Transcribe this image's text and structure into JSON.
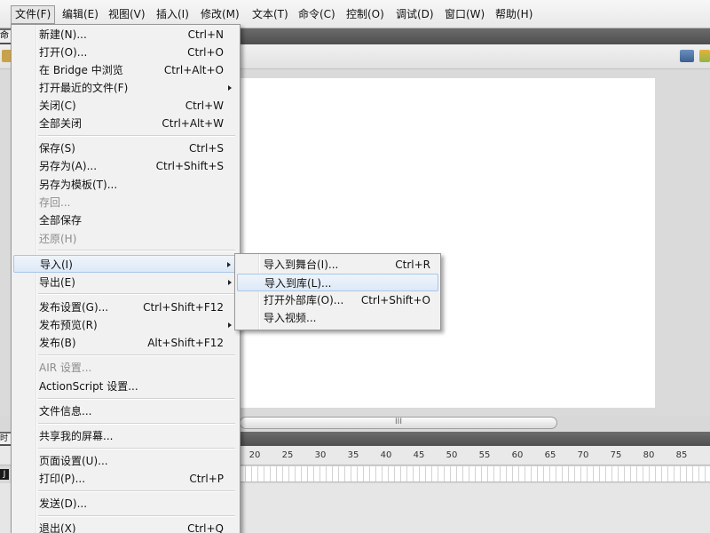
{
  "menubar": {
    "items": [
      "文件(F)",
      "编辑(E)",
      "视图(V)",
      "插入(I)",
      "修改(M)",
      "文本(T)",
      "命令(C)",
      "控制(O)",
      "调试(D)",
      "窗口(W)",
      "帮助(H)"
    ],
    "active": "文件(F)"
  },
  "file_menu": {
    "new": {
      "label": "新建(N)...",
      "shortcut": "Ctrl+N"
    },
    "open": {
      "label": "打开(O)...",
      "shortcut": "Ctrl+O"
    },
    "browse_bridge": {
      "label": "在 Bridge 中浏览",
      "shortcut": "Ctrl+Alt+O"
    },
    "open_recent": {
      "label": "打开最近的文件(F)"
    },
    "close": {
      "label": "关闭(C)",
      "shortcut": "Ctrl+W"
    },
    "close_all": {
      "label": "全部关闭",
      "shortcut": "Ctrl+Alt+W"
    },
    "save": {
      "label": "保存(S)",
      "shortcut": "Ctrl+S"
    },
    "save_as": {
      "label": "另存为(A)...",
      "shortcut": "Ctrl+Shift+S"
    },
    "save_as_template": {
      "label": "另存为模板(T)..."
    },
    "check_in": {
      "label": "存回..."
    },
    "save_all": {
      "label": "全部保存"
    },
    "revert": {
      "label": "还原(H)"
    },
    "import": {
      "label": "导入(I)"
    },
    "export": {
      "label": "导出(E)"
    },
    "publish_settings": {
      "label": "发布设置(G)...",
      "shortcut": "Ctrl+Shift+F12"
    },
    "publish_preview": {
      "label": "发布预览(R)"
    },
    "publish": {
      "label": "发布(B)",
      "shortcut": "Alt+Shift+F12"
    },
    "air_settings": {
      "label": "AIR 设置..."
    },
    "actionscript_settings": {
      "label": "ActionScript 设置..."
    },
    "file_info": {
      "label": "文件信息..."
    },
    "share_screen": {
      "label": "共享我的屏幕..."
    },
    "page_setup": {
      "label": "页面设置(U)..."
    },
    "print": {
      "label": "打印(P)...",
      "shortcut": "Ctrl+P"
    },
    "send": {
      "label": "发送(D)..."
    },
    "exit": {
      "label": "退出(X)",
      "shortcut": "Ctrl+Q"
    }
  },
  "import_submenu": {
    "to_stage": {
      "label": "导入到舞台(I)...",
      "shortcut": "Ctrl+R"
    },
    "to_library": {
      "label": "导入到库(L)..."
    },
    "open_external_library": {
      "label": "打开外部库(O)...",
      "shortcut": "Ctrl+Shift+O"
    },
    "video": {
      "label": "导入视频..."
    }
  },
  "background": {
    "tab_stub": "命令",
    "timeline_stub": "时间轴",
    "scroll_grip": "III",
    "layer_stub": "J"
  },
  "timeline": {
    "ruler_labels": [
      "20",
      "25",
      "30",
      "35",
      "40",
      "45",
      "50",
      "55",
      "60",
      "65",
      "70",
      "75",
      "80",
      "85"
    ]
  }
}
